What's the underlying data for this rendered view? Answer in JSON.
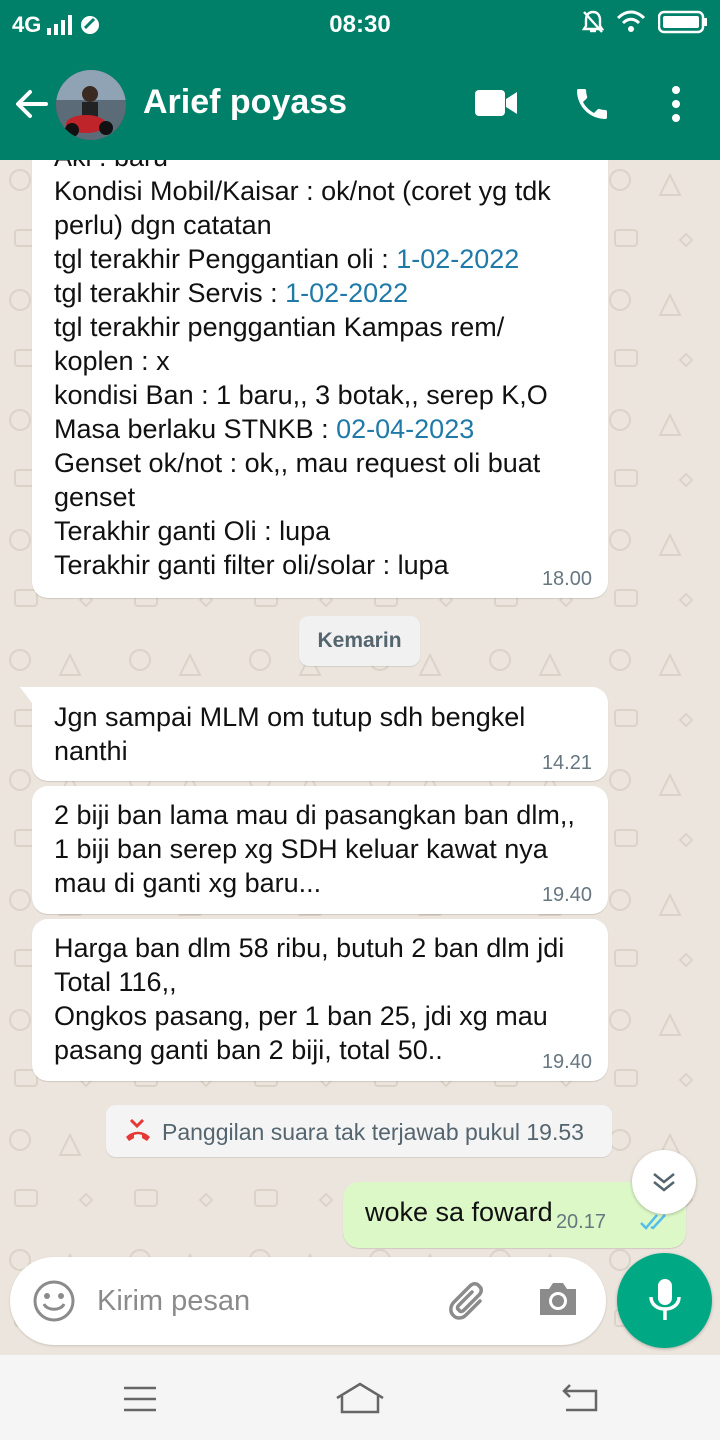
{
  "status_bar": {
    "network": "4G",
    "time": "08:30"
  },
  "header": {
    "contact_name": "Arief poyass"
  },
  "messages": {
    "m1": {
      "lines": [
        "Aki : baru",
        "Kondisi Mobil/Kaisar : ok/not (coret yg tdk perlu) dgn catatan",
        "tgl terakhir Penggantian oli : ",
        "tgl terakhir Servis : ",
        "tgl terakhir penggantian Kampas rem/ koplen : x",
        "kondisi Ban : 1 baru,, 3 botak,, serep K,O",
        "Masa berlaku STNKB : ",
        "Genset ok/not : ok,, mau request oli buat genset",
        "Terakhir ganti Oli : lupa",
        "Terakhir ganti filter oli/solar : lupa"
      ],
      "date_oli": "1-02-2022",
      "date_servis": "1-02-2022",
      "date_stnkb": "02-04-2023",
      "time": "18.00"
    },
    "date_divider": "Kemarin",
    "m2": {
      "text": "Jgn sampai MLM om tutup sdh bengkel nanthi",
      "time": "14.21"
    },
    "m3": {
      "text": "2 biji ban lama mau di pasangkan ban dlm,, 1 biji ban serep xg SDH keluar kawat nya mau di ganti xg baru...",
      "time": "19.40"
    },
    "m4": {
      "text": "Harga ban dlm 58 ribu, butuh 2 ban dlm jdi Total 116,,\nOngkos pasang, per 1 ban 25, jdi xg mau pasang ganti ban 2 biji, total 50..",
      "time": "19.40"
    },
    "missed_call": "Panggilan suara tak terjawab pukul 19.53",
    "m5": {
      "text": "woke sa foward",
      "time": "20.17"
    }
  },
  "composer": {
    "placeholder": "Kirim pesan"
  },
  "colors": {
    "header": "#008069",
    "outgoing": "#dcf8c6",
    "accent": "#00a884",
    "link": "#1f7aa8",
    "missed_call": "#e53935"
  }
}
